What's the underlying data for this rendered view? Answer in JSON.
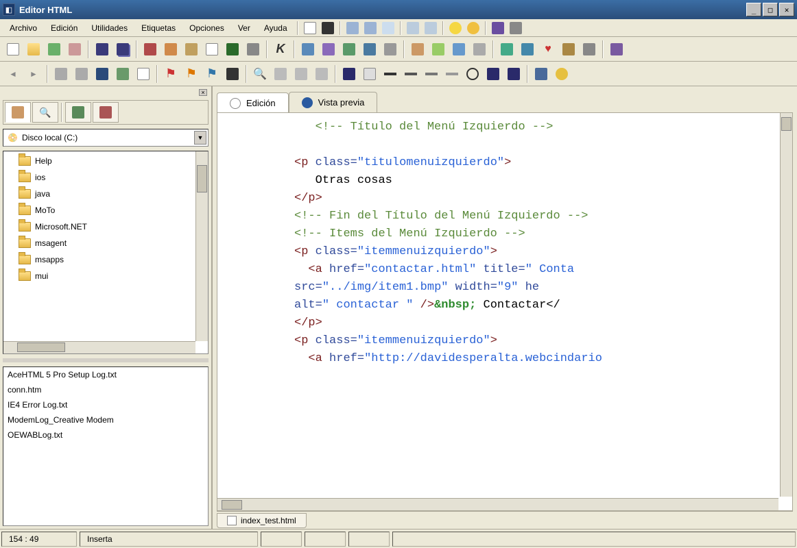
{
  "window": {
    "title": "Editor HTML"
  },
  "menu": {
    "items": [
      "Archivo",
      "Edición",
      "Utilidades",
      "Etiquetas",
      "Opciones",
      "Ver",
      "Ayuda"
    ]
  },
  "toolbar1_icons": [
    "new",
    "open",
    "reopen",
    "|",
    "save",
    "save-all",
    "|",
    "cut",
    "copy",
    "paste",
    "doc",
    "image",
    "print",
    "|",
    "run",
    "|",
    "table",
    "form",
    "link",
    "anchor",
    "|",
    "bold",
    "italic",
    "underline",
    "center",
    "|",
    "color1",
    "color2",
    "heart",
    "color3",
    "|",
    "plugin"
  ],
  "toolbar2_icons": [
    "nav-back",
    "nav-fwd",
    "|",
    "stop",
    "refresh",
    "home",
    "blank",
    "|",
    "flag-red",
    "flag-orange",
    "flag-blue",
    "tag",
    "|",
    "find",
    "find-next",
    "replace",
    "goto",
    "|",
    "bookmark",
    "comment",
    "hr1",
    "hr2",
    "hr3",
    "hr4",
    "circle",
    "rect1",
    "rect2",
    "|",
    "grid",
    "bulb"
  ],
  "sidebar": {
    "tabs": [
      "explorer",
      "search",
      "favorites",
      "history"
    ],
    "drive": "Disco local (C:)",
    "folders": [
      "Help",
      "ios",
      "java",
      "MoTo",
      "Microsoft.NET",
      "msagent",
      "msapps",
      "mui"
    ],
    "files": [
      "AceHTML 5 Pro Setup Log.txt",
      "conn.htm",
      "IE4 Error Log.txt",
      "ModemLog_Creative Modem",
      "OEWABLog.txt"
    ]
  },
  "editor": {
    "tabs": {
      "edit": "Edición",
      "preview": "Vista previa"
    },
    "file_tab": "index_test.html",
    "code": {
      "l1_comment": "<!-- Título del Menú Izquierdo -->",
      "l2_pre": "<p ",
      "l2_attr": "class=",
      "l2_val": "\"titulomenuizquierdo\"",
      "l2_post": ">",
      "l3_text": "Otras cosas",
      "l4": "</p>",
      "l5_comment": "<!-- Fin del Título del Menú Izquierdo -->",
      "l6_comment": "<!-- Items del Menú Izquierdo -->",
      "l7_pre": "<p ",
      "l7_attr": "class=",
      "l7_val": "\"itemmenuizquierdo\"",
      "l7_post": ">",
      "l8_pre": "  <a ",
      "l8_a1": "href=",
      "l8_v1": "\"contactar.html\"",
      "l8_a2": " title=",
      "l8_v2": "\" Conta",
      "l9_a1": "src=",
      "l9_v1": "\"../img/item1.bmp\"",
      "l9_a2": " width=",
      "l9_v2": "\"9\"",
      "l9_post": " he",
      "l10_a1": "alt=",
      "l10_v1": "\" contactar \"",
      "l10_post": " />",
      "l10_ent": "&nbsp;",
      "l10_text": " Contactar</",
      "l11": "</p>",
      "l12_pre": "<p ",
      "l12_attr": "class=",
      "l12_val": "\"itemmenuizquierdo\"",
      "l12_post": ">",
      "l13_pre": "  <a ",
      "l13_a1": "href=",
      "l13_v1": "\"http://davidesperalta.webcindario"
    }
  },
  "status": {
    "pos": "154 : 49",
    "mode": "Inserta"
  }
}
